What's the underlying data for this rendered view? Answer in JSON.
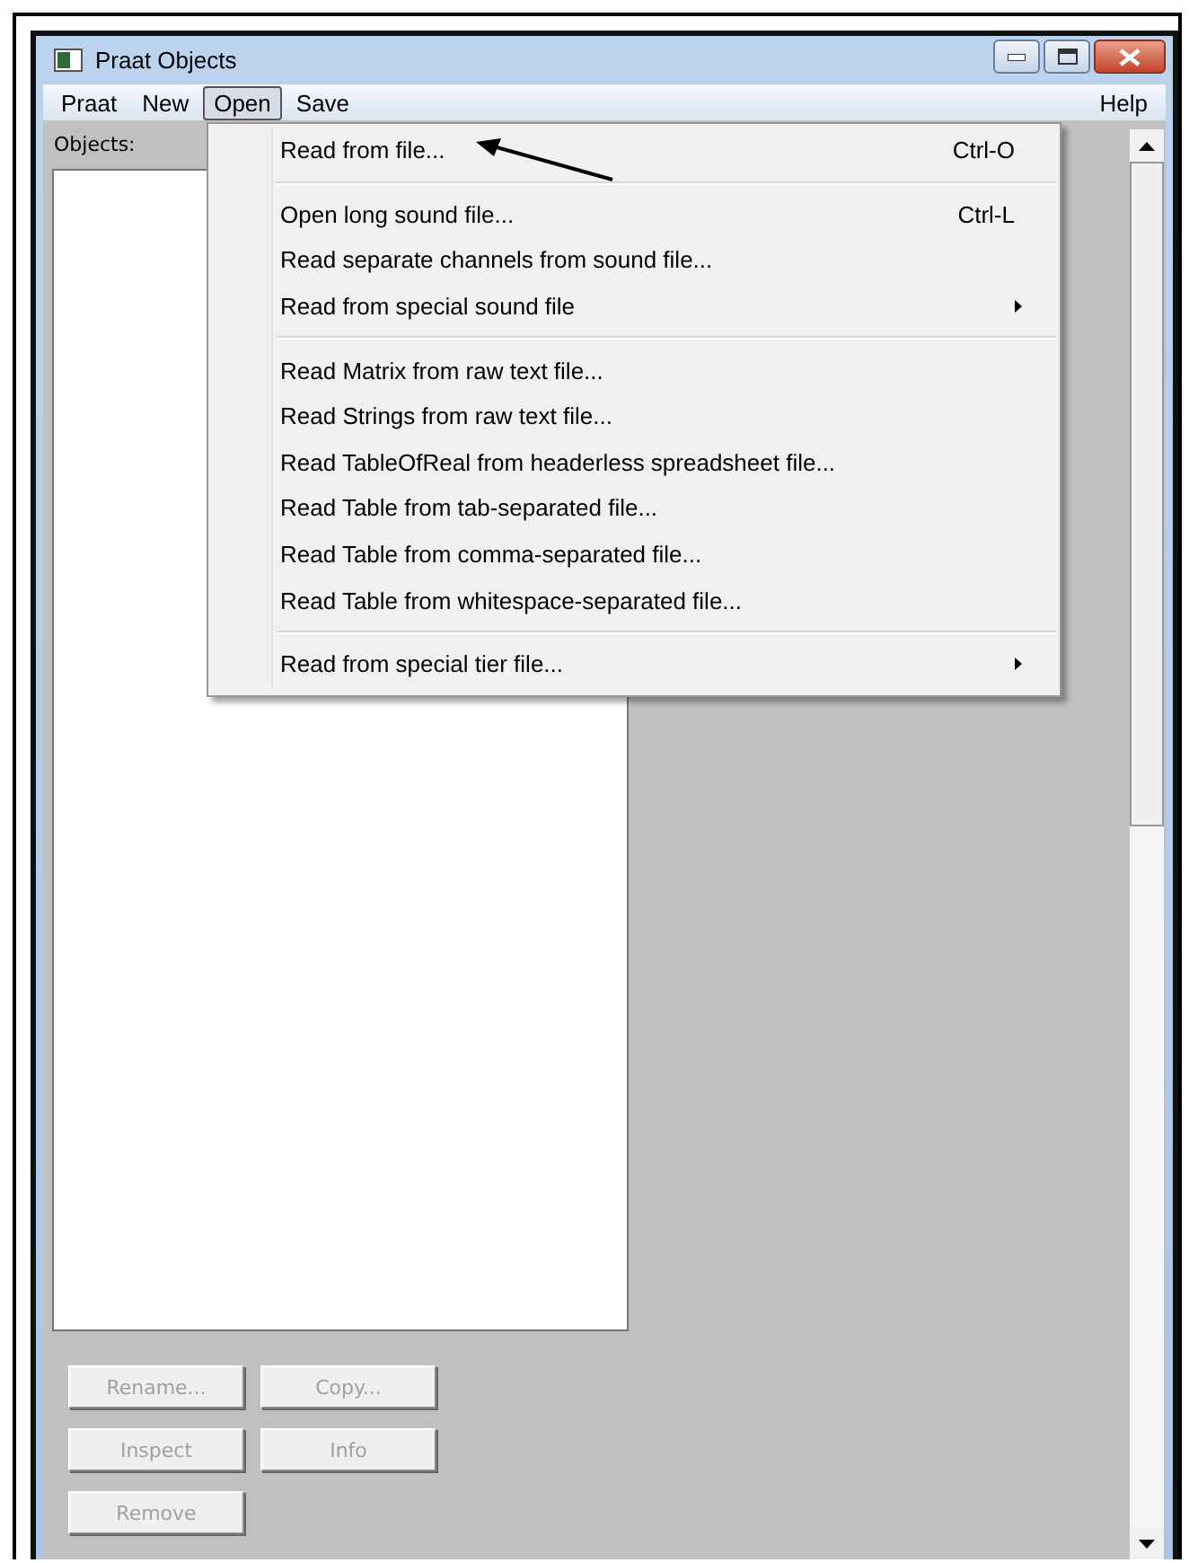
{
  "window": {
    "title": "Praat Objects"
  },
  "menubar": {
    "left": [
      {
        "label": "Praat",
        "selected": false
      },
      {
        "label": "New",
        "selected": false
      },
      {
        "label": "Open",
        "selected": true
      },
      {
        "label": "Save",
        "selected": false
      }
    ],
    "right": [
      {
        "label": "Help",
        "selected": false
      }
    ]
  },
  "objects": {
    "label": "Objects:"
  },
  "buttons": [
    {
      "label": "Rename...",
      "disabled": true
    },
    {
      "label": "Copy...",
      "disabled": true
    },
    {
      "label": "Inspect",
      "disabled": true
    },
    {
      "label": "Info",
      "disabled": true
    },
    {
      "label": "Remove",
      "disabled": true
    }
  ],
  "menu": {
    "groups": [
      [
        {
          "label": "Read from file...",
          "shortcut": "Ctrl-O",
          "submenu": false
        }
      ],
      [
        {
          "label": "Open long sound file...",
          "shortcut": "Ctrl-L",
          "submenu": false
        },
        {
          "label": "Read separate channels from sound file...",
          "submenu": false
        },
        {
          "label": "Read from special sound file",
          "submenu": true
        }
      ],
      [
        {
          "label": "Read Matrix from raw text file...",
          "submenu": false
        },
        {
          "label": "Read Strings from raw text file...",
          "submenu": false
        },
        {
          "label": "Read TableOfReal from headerless spreadsheet file...",
          "submenu": false
        },
        {
          "label": "Read Table from tab-separated file...",
          "submenu": false
        },
        {
          "label": "Read Table from comma-separated file...",
          "submenu": false
        },
        {
          "label": "Read Table from whitespace-separated file...",
          "submenu": false
        }
      ],
      [
        {
          "label": "Read from special tier file...",
          "submenu": true
        }
      ]
    ]
  }
}
